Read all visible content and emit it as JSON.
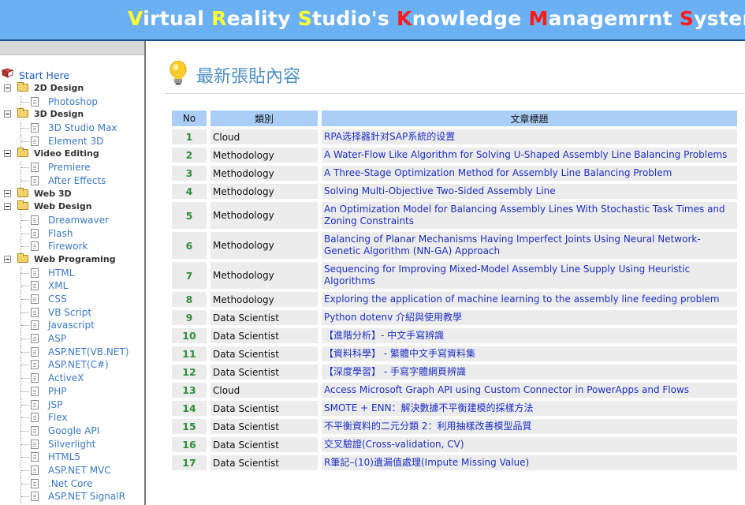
{
  "banner": {
    "title_parts": [
      {
        "text": "V",
        "color": "yellow"
      },
      {
        "text": "irtual ",
        "color": "white"
      },
      {
        "text": "R",
        "color": "yellow"
      },
      {
        "text": "eality ",
        "color": "white"
      },
      {
        "text": "S",
        "color": "yellow"
      },
      {
        "text": "tudio's ",
        "color": "white"
      },
      {
        "text": "K",
        "color": "red"
      },
      {
        "text": "nowledge ",
        "color": "white"
      },
      {
        "text": "M",
        "color": "red"
      },
      {
        "text": "anagemrnt ",
        "color": "white"
      },
      {
        "text": "S",
        "color": "red"
      },
      {
        "text": "ystem",
        "color": "white"
      }
    ]
  },
  "colors": {
    "banner_bg": "#6ab0f3",
    "header_cell_bg": "#aacef6",
    "row_bg": "#ececec",
    "number_green": "#2f8f3a",
    "title_link_blue": "#1e2fc8",
    "heading_blue": "#4f8fc6"
  },
  "sidebar": {
    "start_label": "Start Here",
    "tree": [
      {
        "label": "2D Design",
        "children": [
          "Photoshop"
        ]
      },
      {
        "label": "3D Design",
        "children": [
          "3D Studio Max",
          "Element 3D"
        ]
      },
      {
        "label": "Video Editing",
        "children": [
          "Premiere",
          "After Effects"
        ]
      },
      {
        "label": "Web 3D",
        "children": []
      },
      {
        "label": "Web Design",
        "children": [
          "Dreamwaver",
          "Flash",
          "Firework"
        ]
      },
      {
        "label": "Web Programing",
        "children": [
          "HTML",
          "XML",
          "CSS",
          "VB Script",
          "Javascript",
          "ASP",
          "ASP.NET(VB.NET)",
          "ASP.NET(C#)",
          "ActiveX",
          "PHP",
          "JSP",
          "Flex",
          "Google API",
          "Silverlight",
          "HTML5",
          "ASP.NET MVC",
          ".Net Core",
          "ASP.NET SignalR"
        ]
      }
    ]
  },
  "main": {
    "heading": "最新張貼內容",
    "heading_icon": "lightbulb-icon",
    "table": {
      "headers": [
        "No",
        "類別",
        "文章標題"
      ],
      "rows": [
        {
          "no": "1",
          "category": "Cloud",
          "title": "RPA选择器針对SAP系統的设置"
        },
        {
          "no": "2",
          "category": "Methodology",
          "title": "A Water-Flow Like Algorithm for Solving U-Shaped Assembly Line Balancing Problems"
        },
        {
          "no": "3",
          "category": "Methodology",
          "title": "A Three-Stage Optimization Method for Assembly Line Balancing Problem"
        },
        {
          "no": "4",
          "category": "Methodology",
          "title": "Solving Multi-Objective Two-Sided Assembly Line"
        },
        {
          "no": "5",
          "category": "Methodology",
          "title": "An Optimization Model for Balancing Assembly Lines With Stochastic Task Times and Zoning Constraints"
        },
        {
          "no": "6",
          "category": "Methodology",
          "title": "Balancing of Planar Mechanisms Having Imperfect Joints Using Neural Network-Genetic Algorithm (NN-GA) Approach"
        },
        {
          "no": "7",
          "category": "Methodology",
          "title": "Sequencing for Improving Mixed-Model Assembly Line Supply Using Heuristic Algorithms"
        },
        {
          "no": "8",
          "category": "Methodology",
          "title": "Exploring the application of machine learning to the assembly line feeding problem"
        },
        {
          "no": "9",
          "category": "Data Scientist",
          "title": "Python dotenv 介紹與使用教學"
        },
        {
          "no": "10",
          "category": "Data Scientist",
          "title": "【進階分析】- 中文手寫辨識"
        },
        {
          "no": "11",
          "category": "Data Scientist",
          "title": "【資料科學】 - 繁體中文手寫資料集"
        },
        {
          "no": "12",
          "category": "Data Scientist",
          "title": "【深度學習】 - 手寫字體網頁辨識"
        },
        {
          "no": "13",
          "category": "Cloud",
          "title": "Access Microsoft Graph API using Custom Connector in PowerApps and Flows"
        },
        {
          "no": "14",
          "category": "Data Scientist",
          "title": "SMOTE + ENN：解決數據不平衡建模的採樣方法"
        },
        {
          "no": "15",
          "category": "Data Scientist",
          "title": "不平衡資料的二元分類 2：利用抽樣改善模型品質"
        },
        {
          "no": "16",
          "category": "Data Scientist",
          "title": "交叉驗證(Cross-validation, CV)"
        },
        {
          "no": "17",
          "category": "Data Scientist",
          "title": "R筆記–(10)遺漏值處理(Impute Missing Value)"
        }
      ]
    }
  }
}
